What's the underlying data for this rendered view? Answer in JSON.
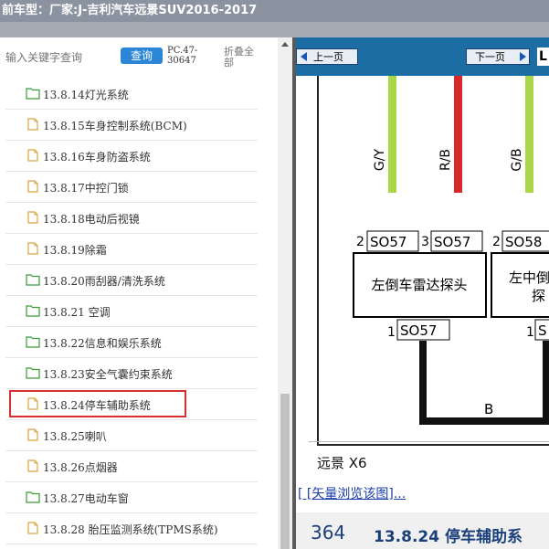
{
  "title": {
    "text": "前车型：厂家:J-吉利汽车远景SUV2016-2017"
  },
  "search": {
    "placeholder": "输入关键字查询",
    "query_label": "查询",
    "code_line1": "PC.47-",
    "code_line2": "30647",
    "collapse_label": "折叠全部"
  },
  "tree": {
    "items": [
      {
        "label": "13.8.14灯光系统",
        "icon": "folder-green-icon"
      },
      {
        "label": "13.8.15车身控制系统(BCM)",
        "icon": "document-icon"
      },
      {
        "label": "13.8.16车身防盗系统",
        "icon": "document-icon"
      },
      {
        "label": "13.8.17中控门锁",
        "icon": "document-icon"
      },
      {
        "label": "13.8.18电动后视镜",
        "icon": "document-icon"
      },
      {
        "label": "13.8.19除霜",
        "icon": "document-icon"
      },
      {
        "label": "13.8.20雨刮器/清洗系统",
        "icon": "folder-green-icon"
      },
      {
        "label": "13.8.21 空调",
        "icon": "folder-green-icon"
      },
      {
        "label": "13.8.22信息和娱乐系统",
        "icon": "folder-green-icon"
      },
      {
        "label": "13.8.23安全气囊约束系统",
        "icon": "folder-green-icon"
      },
      {
        "label": "13.8.24停车辅助系统",
        "icon": "document-icon"
      },
      {
        "label": "13.8.25喇叭",
        "icon": "document-icon"
      },
      {
        "label": "13.8.26点烟器",
        "icon": "document-icon"
      },
      {
        "label": "13.8.27电动车窗",
        "icon": "folder-green-icon"
      },
      {
        "label": "13.8.28 胎压监测系统(TPMS系统)",
        "icon": "document-icon"
      }
    ],
    "selected": "13.8.24停车辅助系统"
  },
  "nav": {
    "prev_label": "上一页",
    "next_label": "下一页",
    "extra_glyph": "L"
  },
  "diagram": {
    "wires": [
      {
        "label": "G/Y",
        "color": "#a8d84a"
      },
      {
        "label": "R/B",
        "color": "#d8282a"
      },
      {
        "label": "G/B",
        "color": "#a8d84a"
      }
    ],
    "pins": [
      {
        "pin": "2",
        "connector": "SO57"
      },
      {
        "pin": "3",
        "connector": "SO57"
      },
      {
        "pin": "2",
        "connector": "SO58"
      },
      {
        "pin": "1",
        "connector": "SO57"
      },
      {
        "pin": "1",
        "connector": "S"
      }
    ],
    "component_left": "左倒车雷达探头",
    "component_right_line1": "左中倒",
    "component_right_line2": "探",
    "ground_label": "B"
  },
  "caption": "远景 X6",
  "vector_link": "[ [矢量浏览该图]...",
  "section": {
    "page": "364",
    "title": "13.8.24 停车辅助系"
  }
}
